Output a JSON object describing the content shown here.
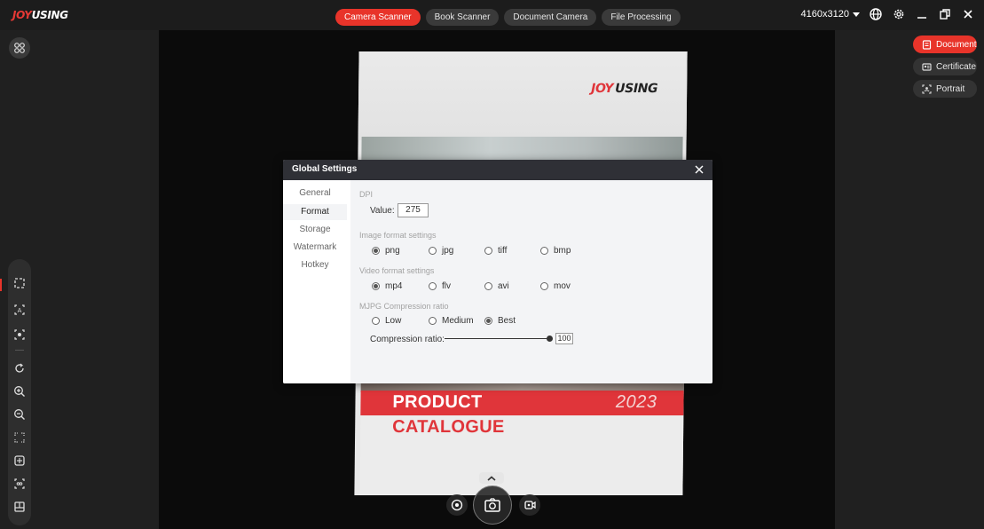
{
  "app": {
    "logo": {
      "part1": "JOY",
      "part2": "USING"
    }
  },
  "modes": [
    {
      "label": "Camera Scanner",
      "active": true
    },
    {
      "label": "Book Scanner",
      "active": false
    },
    {
      "label": "Document Camera",
      "active": false
    },
    {
      "label": "File Processing",
      "active": false
    }
  ],
  "topbar": {
    "resolution": "4160x3120",
    "icons": [
      "globe-icon",
      "gear-icon",
      "minimize-icon",
      "restore-icon",
      "close-icon"
    ]
  },
  "right_panel": {
    "buttons": [
      {
        "label": "Document",
        "icon": "document-icon",
        "active": true
      },
      {
        "label": "Certificate",
        "icon": "id-card-icon",
        "active": false
      },
      {
        "label": "Portrait",
        "icon": "portrait-icon",
        "active": false
      }
    ]
  },
  "left_tools": [
    "crop-auto-icon",
    "text-ocr-icon",
    "focus-icon",
    "rotate-icon",
    "zoom-in-icon",
    "zoom-out-icon",
    "fit-screen-icon",
    "center-icon",
    "scan-region-icon",
    "split-icon"
  ],
  "preview": {
    "paper_logo": {
      "part1": "JOY",
      "part2": "USING"
    },
    "product_title": "PRODUCT",
    "product_year": "2023",
    "product_subtitle": "CATALOGUE"
  },
  "dialog": {
    "title": "Global Settings",
    "nav": [
      {
        "label": "General",
        "active": false
      },
      {
        "label": "Format",
        "active": true
      },
      {
        "label": "Storage",
        "active": false
      },
      {
        "label": "Watermark",
        "active": false
      },
      {
        "label": "Hotkey",
        "active": false
      }
    ],
    "dpi": {
      "section_label": "DPI",
      "value_label": "Value:",
      "value": "275"
    },
    "image_format": {
      "section_label": "Image format settings",
      "options": [
        {
          "label": "png",
          "selected": true
        },
        {
          "label": "jpg",
          "selected": false
        },
        {
          "label": "tiff",
          "selected": false
        },
        {
          "label": "bmp",
          "selected": false
        }
      ]
    },
    "video_format": {
      "section_label": "Video format settings",
      "options": [
        {
          "label": "mp4",
          "selected": true
        },
        {
          "label": "flv",
          "selected": false
        },
        {
          "label": "avi",
          "selected": false
        },
        {
          "label": "mov",
          "selected": false
        }
      ]
    },
    "mjpg": {
      "section_label": "MJPG Compression ratio",
      "options": [
        {
          "label": "Low",
          "selected": false
        },
        {
          "label": "Medium",
          "selected": false
        },
        {
          "label": "Best",
          "selected": true
        }
      ],
      "ratio_label": "Compression ratio:",
      "ratio_value": "100",
      "ratio_fraction": 1.0
    }
  }
}
